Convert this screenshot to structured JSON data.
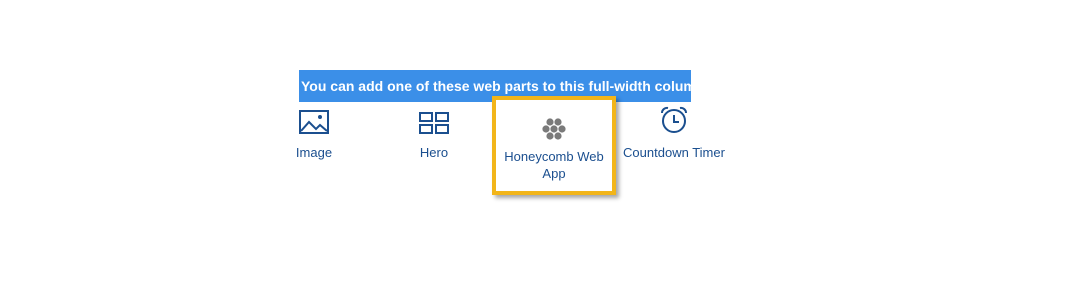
{
  "header": {
    "text": "You can add one of these web parts to this full-width column"
  },
  "parts": [
    {
      "label": "Image",
      "icon": "image-icon"
    },
    {
      "label": "Hero",
      "icon": "hero-layout-icon"
    },
    {
      "label": "Honeycomb Web App",
      "icon": "honeycomb-icon",
      "selected": true
    },
    {
      "label": "Countdown Timer",
      "icon": "alarm-clock-icon"
    }
  ],
  "colors": {
    "accent": "#3b8fe8",
    "highlight": "#f2b51a",
    "text": "#1b4f8f"
  }
}
